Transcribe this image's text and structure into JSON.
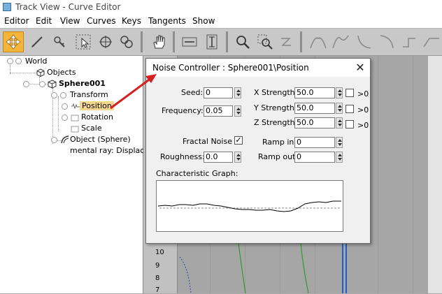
{
  "window": {
    "title": "Track View - Curve Editor"
  },
  "menu": [
    "Editor",
    "Edit",
    "View",
    "Curves",
    "Keys",
    "Tangents",
    "Show"
  ],
  "toolbar": {
    "buttons": [
      "move-keys-icon",
      "draw-curves-icon",
      "add-keys-icon",
      "select-icon",
      "scale-keys-icon",
      "scale-values-icon",
      "pan-icon",
      "zoom-extents-horizontal-icon",
      "zoom-extents-vertical-icon",
      "zoom-icon",
      "zoom-region-icon",
      "slide-keys-icon",
      "tangent-auto-icon",
      "tangent-spline-icon",
      "tangent-fast-icon",
      "tangent-slow-icon",
      "tangent-step-icon",
      "tangent-linear-icon"
    ]
  },
  "tree": {
    "world": "World",
    "objects": "Objects",
    "sphere": "Sphere001",
    "transform": "Transform",
    "position": "Position",
    "rotation": "Rotation",
    "scale": "Scale",
    "object_sphere": "Object (Sphere)",
    "mental_ray": "mental ray: Displacer"
  },
  "curve_axis": [
    "10",
    "9",
    "8",
    "7"
  ],
  "dialog": {
    "title": "Noise Controller : Sphere001\\Position",
    "seed_label": "Seed:",
    "seed_value": "0",
    "frequency_label": "Frequency:",
    "frequency_value": "0.05",
    "fractal_noise_label": "Fractal Noise",
    "fractal_noise_checked": true,
    "roughness_label": "Roughness:",
    "roughness_value": "0.0",
    "x_strength_label": "X Strength:",
    "x_strength_value": "50.0",
    "y_strength_label": "Y Strength:",
    "y_strength_value": "50.0",
    "z_strength_label": "Z Strength:",
    "z_strength_value": "50.0",
    "gt0_label": ">0",
    "ramp_in_label": "Ramp in:",
    "ramp_in_value": "0",
    "ramp_out_label": "Ramp out:",
    "ramp_out_value": "0",
    "graph_label": "Characteristic Graph:"
  },
  "colors": {
    "highlight": "#f5d78e",
    "arrow": "#d42020",
    "toolbar_active": "#f2b43a",
    "curve_green": "#2f9a2f",
    "curve_blue": "#1f5fd0"
  }
}
